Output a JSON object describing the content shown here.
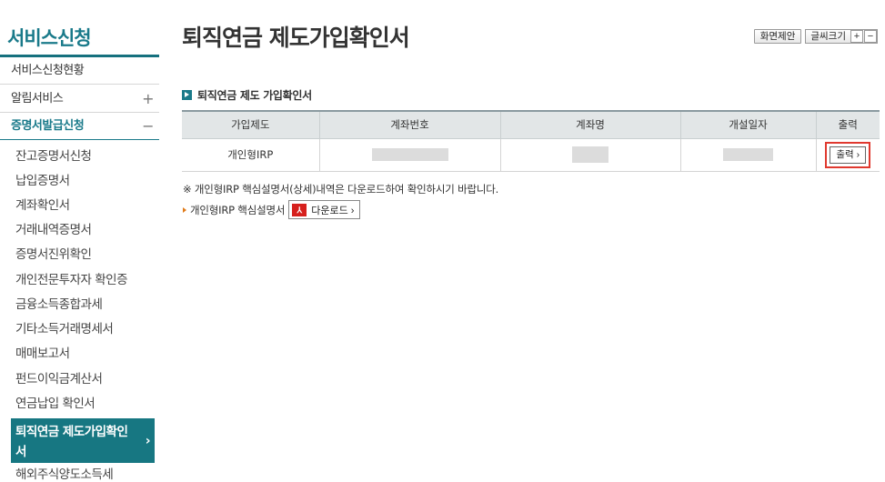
{
  "sidebar": {
    "title": "서비스신청",
    "menu": [
      {
        "label": "서비스신청현황",
        "toggle": ""
      },
      {
        "label": "알림서비스",
        "toggle": "+"
      },
      {
        "label": "증명서발급신청",
        "toggle": "−"
      }
    ],
    "sub_items": [
      {
        "label": "잔고증명서신청"
      },
      {
        "label": "납입증명서"
      },
      {
        "label": "계좌확인서"
      },
      {
        "label": "거래내역증명서"
      },
      {
        "label": "증명서진위확인"
      },
      {
        "label": "개인전문투자자 확인증"
      },
      {
        "label": "금융소득종합과세"
      },
      {
        "label": "기타소득거래명세서"
      },
      {
        "label": "매매보고서"
      },
      {
        "label": "펀드이익금계산서"
      },
      {
        "label": "연금납입 확인서"
      },
      {
        "label": "퇴직연금 제도가입확인서",
        "arrow": "›"
      },
      {
        "label": "해외주식양도소득세"
      }
    ]
  },
  "header": {
    "title": "퇴직연금 제도가입확인서",
    "suggest_label": "화면제안",
    "font_size_label": "글씨크기",
    "font_plus": "+",
    "font_minus": "−"
  },
  "section": {
    "title": "퇴직연금 제도 가입확인서"
  },
  "table": {
    "headers": [
      "가입제도",
      "계좌번호",
      "계좌명",
      "개설일자",
      "출력"
    ],
    "row": {
      "plan": "개인형IRP",
      "print_label": "출력 ›"
    }
  },
  "notice": "※ 개인형IRP 핵심설명서(상세)내역은 다운로드하여 확인하시기 바랍니다.",
  "download": {
    "label": "개인형IRP 핵심설명서",
    "button_label": "다운로드 ›"
  },
  "colors": {
    "accent": "#177782",
    "highlight": "#e0392f"
  }
}
